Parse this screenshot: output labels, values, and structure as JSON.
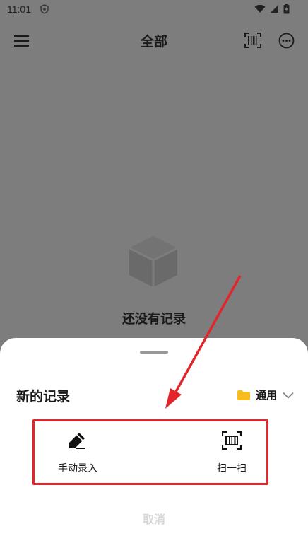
{
  "status_bar": {
    "time": "11:01"
  },
  "header": {
    "title": "全部",
    "menu_icon": "hamburger-menu-icon",
    "barcode_icon": "barcode-scan-icon",
    "more_icon": "more-options-icon"
  },
  "empty_state": {
    "icon": "cube-box-icon",
    "text": "还没有记录"
  },
  "sheet": {
    "title": "新的记录",
    "folder": {
      "label": "通用",
      "color": "#f7bd1f"
    },
    "actions": [
      {
        "label": "手动录入",
        "icon": "pencil-icon"
      },
      {
        "label": "扫一扫",
        "icon": "scan-icon"
      }
    ],
    "cancel_label": "取消"
  },
  "colors": {
    "overlay": "#7d7d7d",
    "annotation_red": "#e3252b",
    "sheet_bg": "#ffffff"
  }
}
